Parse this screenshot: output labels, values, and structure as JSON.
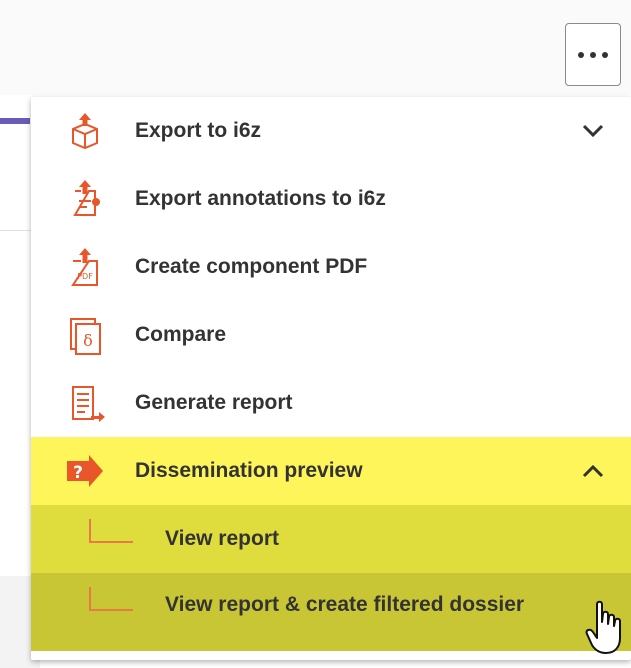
{
  "toolbar": {
    "more_label": "More actions"
  },
  "menu": {
    "items": [
      {
        "label": "Export to i6z",
        "icon": "export-package-icon"
      },
      {
        "label": "Export annotations to i6z",
        "icon": "export-annotations-icon"
      },
      {
        "label": "Create component PDF",
        "icon": "pdf-icon"
      },
      {
        "label": "Compare",
        "icon": "compare-icon"
      },
      {
        "label": "Generate report",
        "icon": "report-icon"
      },
      {
        "label": "Dissemination preview",
        "icon": "dissemination-icon",
        "expanded": true
      }
    ],
    "subitems": [
      {
        "label": "View report"
      },
      {
        "label": "View report & create filtered dossier"
      }
    ]
  },
  "colors": {
    "accent": "#e8562a",
    "highlight": "#fdf55a",
    "highlight_sub": "#dfdc3d",
    "highlight_hover": "#c9c635"
  }
}
